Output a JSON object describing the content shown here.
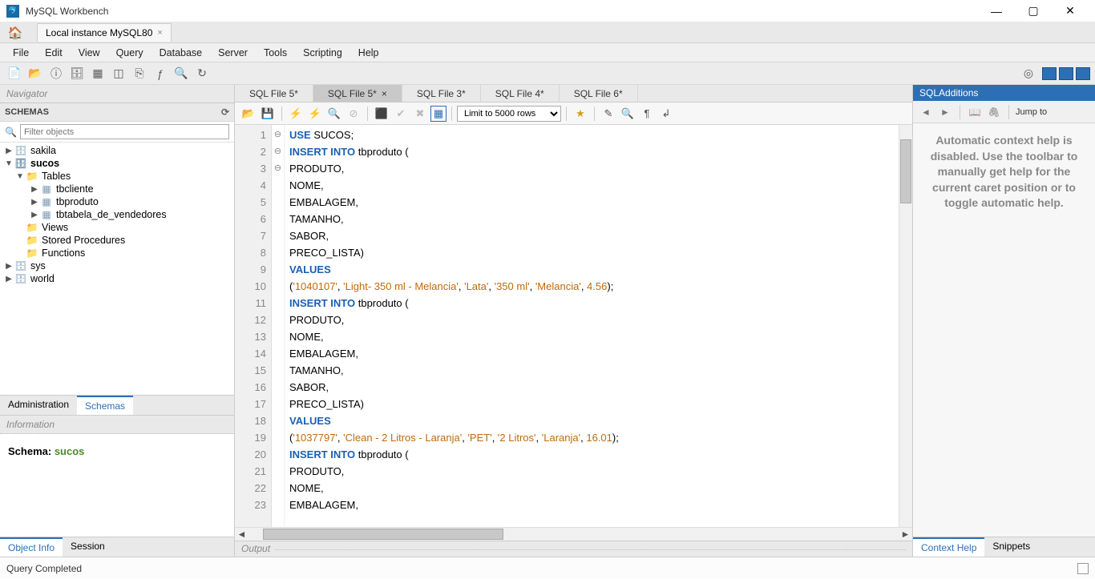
{
  "app": {
    "title": "MySQL Workbench"
  },
  "connection": {
    "name": "Local instance MySQL80"
  },
  "menu": [
    "File",
    "Edit",
    "View",
    "Query",
    "Database",
    "Server",
    "Tools",
    "Scripting",
    "Help"
  ],
  "navigator": {
    "title": "Navigator",
    "schemas_label": "SCHEMAS",
    "filter_placeholder": "Filter objects",
    "tree": [
      {
        "level": 0,
        "arrow": "▶",
        "icon": "db",
        "label": "sakila",
        "bold": false
      },
      {
        "level": 0,
        "arrow": "▼",
        "icon": "db",
        "label": "sucos",
        "bold": true
      },
      {
        "level": 1,
        "arrow": "▼",
        "icon": "folder",
        "label": "Tables",
        "bold": false
      },
      {
        "level": 2,
        "arrow": "▶",
        "icon": "table",
        "label": "tbcliente",
        "bold": false
      },
      {
        "level": 2,
        "arrow": "▶",
        "icon": "table",
        "label": "tbproduto",
        "bold": false
      },
      {
        "level": 2,
        "arrow": "▶",
        "icon": "table",
        "label": "tbtabela_de_vendedores",
        "bold": false
      },
      {
        "level": 1,
        "arrow": "",
        "icon": "folder",
        "label": "Views",
        "bold": false
      },
      {
        "level": 1,
        "arrow": "",
        "icon": "folder",
        "label": "Stored Procedures",
        "bold": false
      },
      {
        "level": 1,
        "arrow": "",
        "icon": "folder",
        "label": "Functions",
        "bold": false
      },
      {
        "level": 0,
        "arrow": "▶",
        "icon": "db",
        "label": "sys",
        "bold": false
      },
      {
        "level": 0,
        "arrow": "▶",
        "icon": "db",
        "label": "world",
        "bold": false
      }
    ],
    "tabs": {
      "admin": "Administration",
      "schemas": "Schemas"
    },
    "info_title": "Information",
    "info_schema_label": "Schema:",
    "info_schema_value": "sucos",
    "bottom_tabs": {
      "objinfo": "Object Info",
      "session": "Session"
    }
  },
  "editor": {
    "tabs": [
      "SQL File 5*",
      "SQL File 5*",
      "SQL File 3*",
      "SQL File 4*",
      "SQL File 6*"
    ],
    "active_tab": 1,
    "limit_label": "Limit to 5000 rows",
    "lines": [
      {
        "n": 1,
        "dot": true,
        "mark": "",
        "html": "<span class='kw'>USE</span> SUCOS;"
      },
      {
        "n": 2,
        "dot": true,
        "mark": "⊖",
        "html": "<span class='kw'>INSERT INTO</span> tbproduto ("
      },
      {
        "n": 3,
        "dot": false,
        "mark": "",
        "html": "PRODUTO,"
      },
      {
        "n": 4,
        "dot": false,
        "mark": "",
        "html": "NOME,"
      },
      {
        "n": 5,
        "dot": false,
        "mark": "",
        "html": "EMBALAGEM,"
      },
      {
        "n": 6,
        "dot": false,
        "mark": "",
        "html": "TAMANHO,"
      },
      {
        "n": 7,
        "dot": false,
        "mark": "",
        "html": "SABOR,"
      },
      {
        "n": 8,
        "dot": false,
        "mark": "",
        "html": "PRECO_LISTA)"
      },
      {
        "n": 9,
        "dot": false,
        "mark": "",
        "html": "<span class='kw'>VALUES</span>"
      },
      {
        "n": 10,
        "dot": false,
        "mark": "",
        "html": "(<span class='str'>'1040107'</span>, <span class='str'>'Light- 350 ml - Melancia'</span>, <span class='str'>'Lata'</span>, <span class='str'>'350 ml'</span>, <span class='str'>'Melancia'</span>, <span class='num'>4.56</span>);"
      },
      {
        "n": 11,
        "dot": true,
        "mark": "⊖",
        "html": "<span class='kw'>INSERT INTO</span> tbproduto ("
      },
      {
        "n": 12,
        "dot": false,
        "mark": "",
        "html": "PRODUTO,"
      },
      {
        "n": 13,
        "dot": false,
        "mark": "",
        "html": "NOME,"
      },
      {
        "n": 14,
        "dot": false,
        "mark": "",
        "html": "EMBALAGEM,"
      },
      {
        "n": 15,
        "dot": false,
        "mark": "",
        "html": "TAMANHO,"
      },
      {
        "n": 16,
        "dot": false,
        "mark": "",
        "html": "SABOR,"
      },
      {
        "n": 17,
        "dot": false,
        "mark": "",
        "html": "PRECO_LISTA)"
      },
      {
        "n": 18,
        "dot": false,
        "mark": "",
        "html": "<span class='kw'>VALUES</span>"
      },
      {
        "n": 19,
        "dot": false,
        "mark": "",
        "html": "(<span class='str'>'1037797'</span>, <span class='str'>'Clean - 2 Litros - Laranja'</span>, <span class='str'>'PET'</span>, <span class='str'>'2 Litros'</span>, <span class='str'>'Laranja'</span>, <span class='num'>16.01</span>);"
      },
      {
        "n": 20,
        "dot": true,
        "mark": "⊖",
        "html": "<span class='kw'>INSERT INTO</span> tbproduto ("
      },
      {
        "n": 21,
        "dot": false,
        "mark": "",
        "html": "PRODUTO,"
      },
      {
        "n": 22,
        "dot": false,
        "mark": "",
        "html": "NOME,"
      },
      {
        "n": 23,
        "dot": false,
        "mark": "",
        "html": "EMBALAGEM,"
      }
    ],
    "output_label": "Output"
  },
  "right": {
    "title": "SQLAdditions",
    "jump_label": "Jump to",
    "help_text": "Automatic context help is disabled. Use the toolbar to manually get help for the current caret position or to toggle automatic help.",
    "tabs": {
      "context": "Context Help",
      "snippets": "Snippets"
    }
  },
  "status": {
    "text": "Query Completed"
  }
}
